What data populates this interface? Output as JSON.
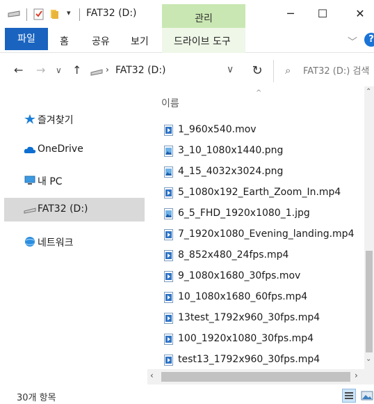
{
  "window": {
    "title": "FAT32 (D:)",
    "context_tab_group": "관리",
    "qat_dropdown": "▾",
    "minimize": "─",
    "maximize": "☐",
    "close": "✕"
  },
  "ribbon": {
    "tabs": [
      "파일",
      "홈",
      "공유",
      "보기"
    ],
    "context_tab": "드라이브 도구",
    "collapse": "﹀",
    "help": "?"
  },
  "nav": {
    "back": "←",
    "forward": "→",
    "recent": "∨",
    "up": "↑",
    "address_arrow": "›",
    "address": "FAT32 (D:)",
    "address_dropdown": "∨",
    "refresh": "↻",
    "search_icon": "⌕",
    "search_placeholder": "FAT32 (D:) 검색"
  },
  "sidebar": {
    "items": [
      {
        "label": "즐겨찾기",
        "icon": "star-icon",
        "selected": false
      },
      {
        "label": "OneDrive",
        "icon": "cloud-icon",
        "selected": false
      },
      {
        "label": "내 PC",
        "icon": "computer-icon",
        "selected": false
      },
      {
        "label": "FAT32  (D:)",
        "icon": "drive-icon",
        "selected": true
      },
      {
        "label": "네트워크",
        "icon": "network-icon",
        "selected": false
      }
    ]
  },
  "list": {
    "column_name": "이름",
    "sort_indicator": "^",
    "partial_row": "· · · ·",
    "files": [
      {
        "name": "1_960x540.mov",
        "type": "video"
      },
      {
        "name": "3_10_1080x1440.png",
        "type": "image"
      },
      {
        "name": "4_15_4032x3024.png",
        "type": "image"
      },
      {
        "name": "5_1080x192_Earth_Zoom_In.mp4",
        "type": "video"
      },
      {
        "name": "6_5_FHD_1920x1080_1.jpg",
        "type": "image"
      },
      {
        "name": "7_1920x1080_Evening_landing.mp4",
        "type": "video"
      },
      {
        "name": "8_852x480_24fps.mp4",
        "type": "video"
      },
      {
        "name": "9_1080x1680_30fps.mov",
        "type": "video"
      },
      {
        "name": "10_1080x1680_60fps.mp4",
        "type": "video"
      },
      {
        "name": "13test_1792x960_30fps.mp4",
        "type": "video"
      },
      {
        "name": "100_1920x1080_30fps.mp4",
        "type": "video"
      },
      {
        "name": "test13_1792x960_30fps.mp4",
        "type": "video"
      }
    ]
  },
  "scroll": {
    "up": "⌃",
    "down": "⌄",
    "left": "‹",
    "right": "›"
  },
  "status": {
    "item_count": "30개 항목"
  },
  "colors": {
    "accent": "#1a64c0",
    "context_tab": "#c9e7b2",
    "selection": "#d9d9d9"
  }
}
